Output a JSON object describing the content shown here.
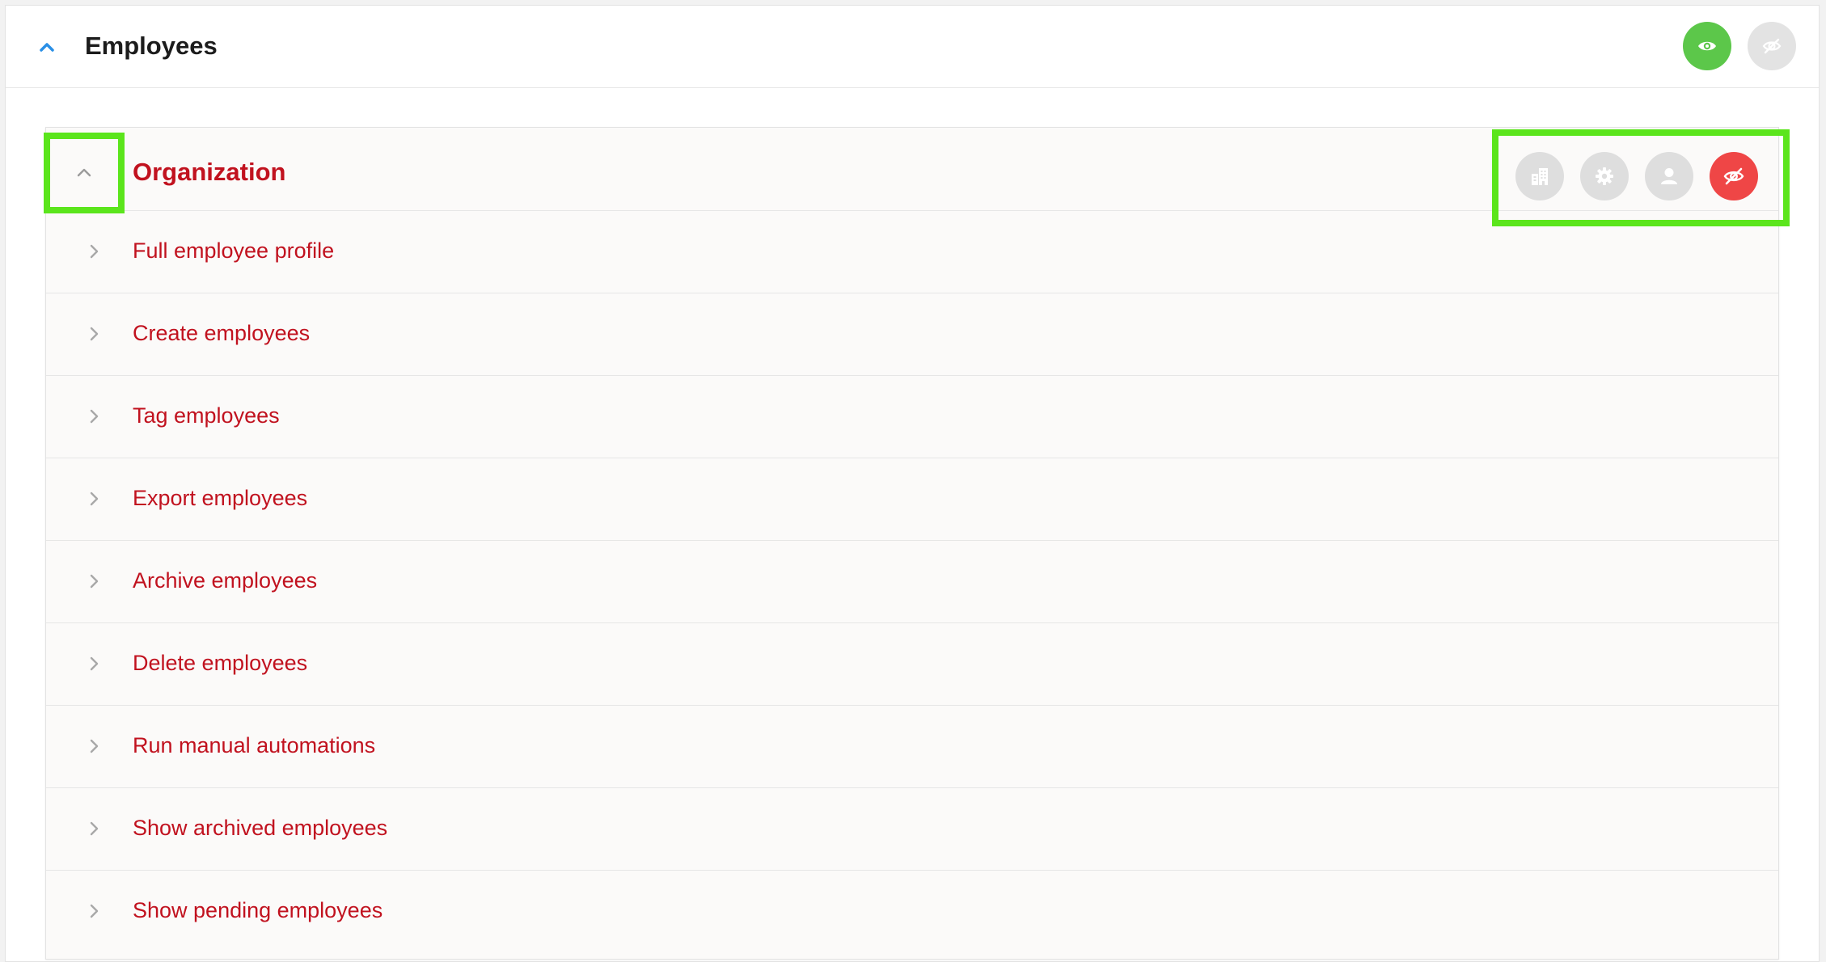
{
  "header": {
    "title": "Employees",
    "show_button_color": "#5cc74a",
    "hide_button_color": "#e3e3e3"
  },
  "section": {
    "title": "Organization",
    "permission_buttons": [
      {
        "icon": "building-icon"
      },
      {
        "icon": "gear-icon"
      },
      {
        "icon": "user-icon"
      },
      {
        "icon": "eye-slash-icon",
        "color": "#ef4646"
      }
    ],
    "items": [
      {
        "label": "Full employee profile"
      },
      {
        "label": "Create employees"
      },
      {
        "label": "Tag employees"
      },
      {
        "label": "Export employees"
      },
      {
        "label": "Archive employees"
      },
      {
        "label": "Delete employees"
      },
      {
        "label": "Run manual automations"
      },
      {
        "label": "Show archived employees"
      },
      {
        "label": "Show pending employees"
      }
    ]
  },
  "colors": {
    "accent_red": "#c1121f",
    "highlight_green": "#5be51c",
    "chevron_blue": "#2a8fe6"
  }
}
